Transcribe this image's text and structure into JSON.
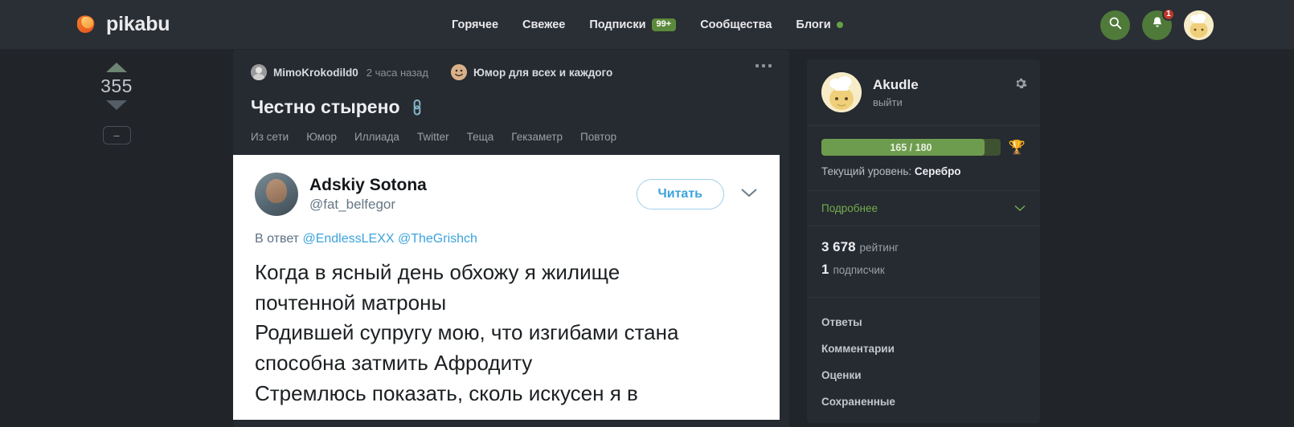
{
  "header": {
    "logo_text": "pikabu",
    "logo_icon": "pikabu-logo-icon",
    "nav": [
      {
        "label": "Горячее",
        "badge": null,
        "dot": false
      },
      {
        "label": "Свежее",
        "badge": null,
        "dot": false
      },
      {
        "label": "Подписки",
        "badge": "99+",
        "dot": false
      },
      {
        "label": "Сообщества",
        "badge": null,
        "dot": false
      },
      {
        "label": "Блоги",
        "badge": null,
        "dot": true
      }
    ],
    "search_icon": "search-icon",
    "bell_icon": "bell-icon",
    "bell_badge": "1",
    "avatar_icon": "user-avatar"
  },
  "post": {
    "vote_count": "355",
    "minus_label": "–",
    "author": "MimoKrokodild0",
    "time": "2 часа назад",
    "community": "Юмор для всех и каждого",
    "menu_icon": "more-dots-icon",
    "title": "Честно стырено",
    "link_icon": "link-icon",
    "tags": [
      "Из сети",
      "Юмор",
      "Иллиада",
      "Twitter",
      "Теща",
      "Гекзаметр",
      "Повтор"
    ]
  },
  "tweet": {
    "display_name": "Adskiy Sotona",
    "handle": "@fat_belfegor",
    "read_button": "Читать",
    "chevron_icon": "chevron-down-icon",
    "reply_prefix": "В ответ ",
    "reply_mentions": "@EndlessLEXX @TheGrishch",
    "text": "Когда в ясный день обхожу я жилище\nпочтенной матроны\nРодившей супругу мою, что изгибами стана\nспособна затмить Афродиту\nСтремлюсь показать, сколь искусен я в"
  },
  "sidebar": {
    "username": "Akudle",
    "logout": "выйти",
    "gear_icon": "gear-icon",
    "progress_label": "165 / 180",
    "progress_percent": 91,
    "trophy_icon": "trophy-icon",
    "level_prefix": "Текущий уровень: ",
    "level_value": "Серебро",
    "more_label": "Подробнее",
    "more_chevron": "chevron-down-icon",
    "rating_value": "3 678",
    "rating_label": "рейтинг",
    "subs_value": "1",
    "subs_label": "подписчик",
    "menu": [
      "Ответы",
      "Комментарии",
      "Оценки",
      "Сохраненные"
    ]
  },
  "colors": {
    "page_bg": "#212429",
    "header_bg": "#2a2e35",
    "card_bg": "#262a31",
    "accent_green": "#72ad4d",
    "badge_red": "#c0392b",
    "twitter_blue": "#3ba3dd"
  }
}
